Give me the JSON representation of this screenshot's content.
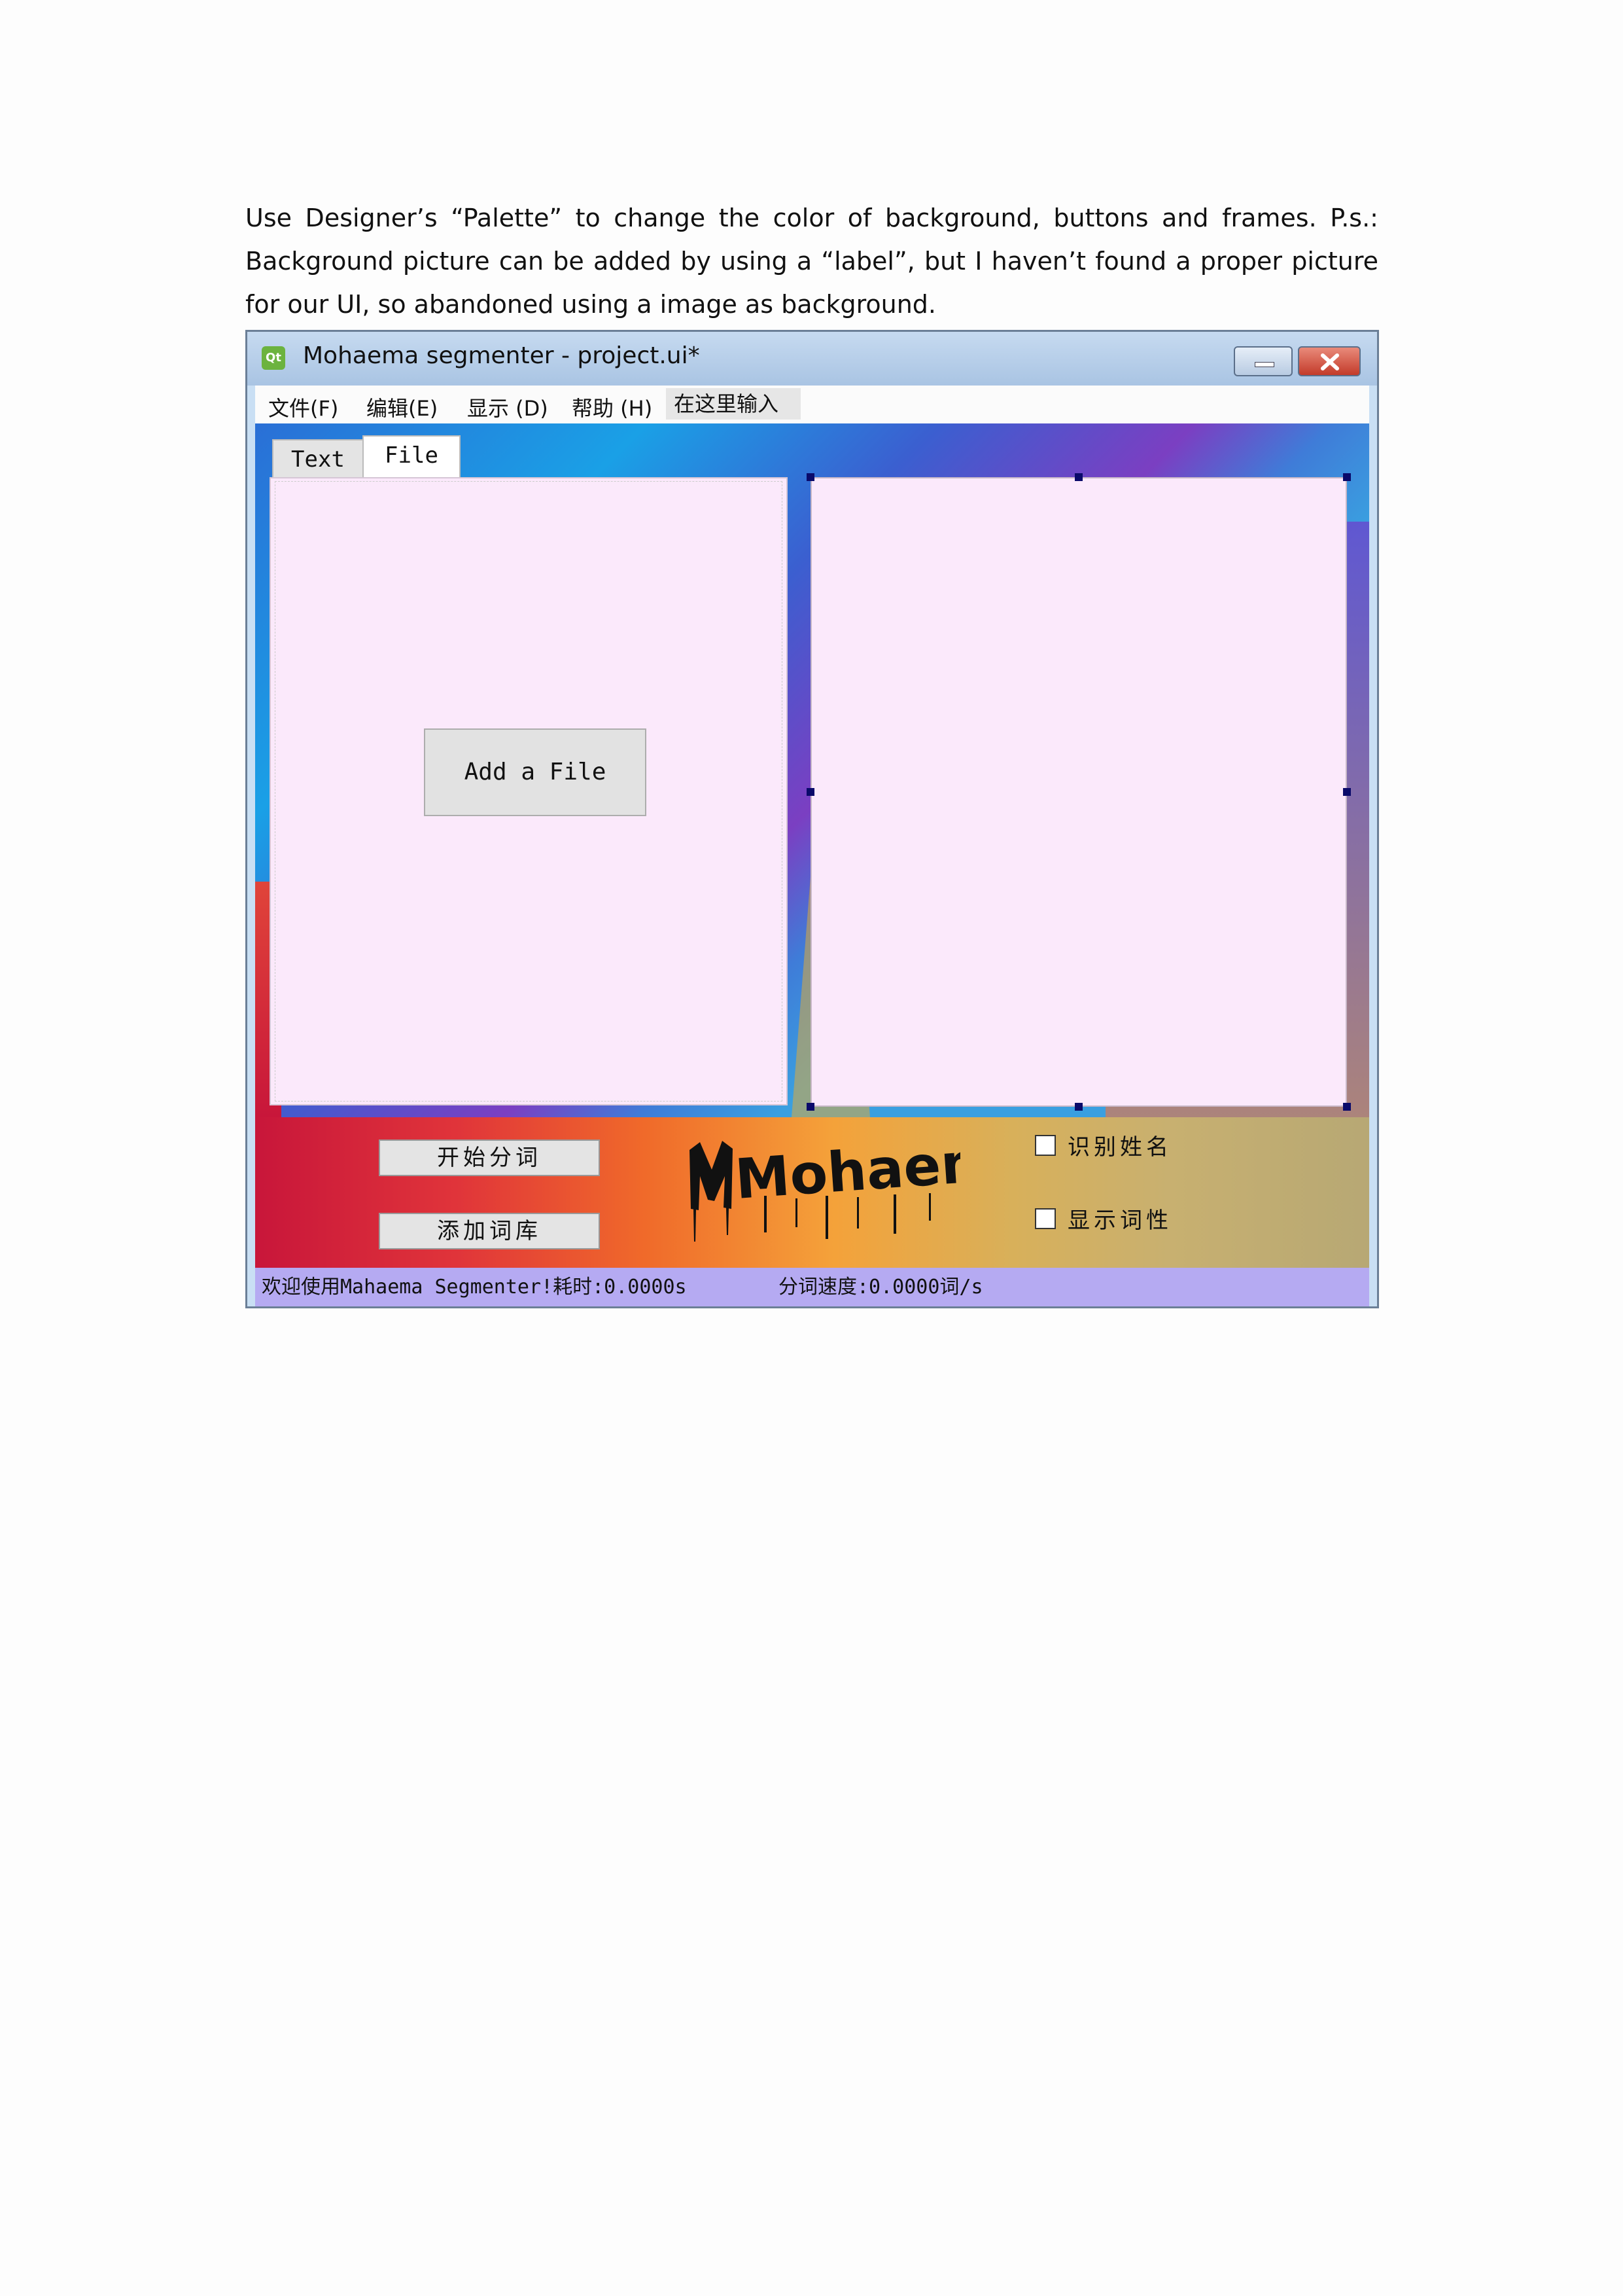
{
  "paragraph": "Use Designer’s “Palette” to change the color of background, buttons and frames. P.s.: Background picture can be added by using a “label”, but I haven’t found a proper picture for our UI, so abandoned using a image as background.",
  "window": {
    "icon_text": "Qt",
    "title": "Mohaema segmenter - project.ui*"
  },
  "menubar": {
    "items": [
      "文件(F)",
      "编辑(E)",
      "显示 (D)",
      "帮助 (H)"
    ],
    "input_placeholder": "在这里输入"
  },
  "tabs": [
    "Text",
    "File"
  ],
  "add_file_button": "Add a File",
  "buttons": {
    "start_segment": "开始分词",
    "add_dictionary": "添加词库"
  },
  "logo_text": "Mohaema",
  "checkboxes": [
    {
      "label": "识别姓名",
      "checked": false
    },
    {
      "label": "显示词性",
      "checked": false
    }
  ],
  "status": {
    "message": "欢迎使用Mahaema Segmenter!耗时:0.0000s",
    "speed": "分词速度:0.0000词/s"
  }
}
